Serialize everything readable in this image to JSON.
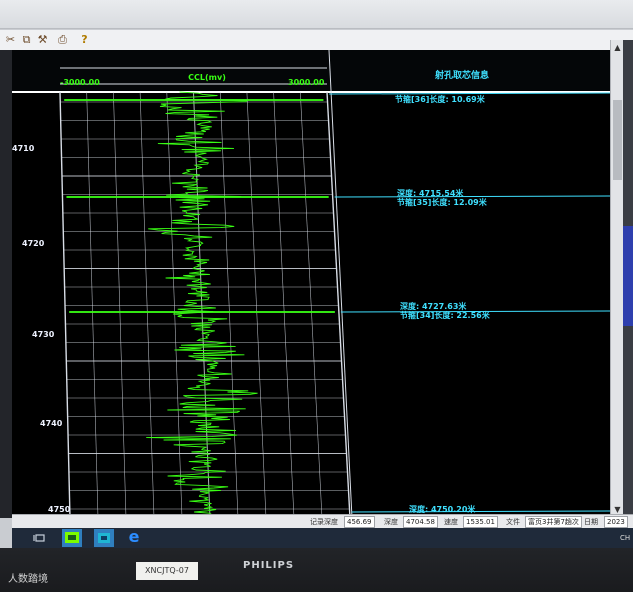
{
  "plot": {
    "ccl_title": "CCL(mv)",
    "ccl_min": "-3000.00",
    "ccl_max": "3000.00",
    "info_title": "射孔取芯信息",
    "depth_labels": [
      "4710",
      "4720",
      "4730",
      "4740",
      "4750"
    ]
  },
  "annotations": {
    "a36_length": "节箍[36]长度: 10.69米",
    "a35_depth": "深度: 4715.54米",
    "a35_length": "节箍[35]长度: 12.09米",
    "a34_depth": "深度: 4727.63米",
    "a34_length": "节箍[34]长度: 22.56米",
    "a33_depth": "深度: 4750.20米"
  },
  "status": {
    "record_depth_label": "记录深度",
    "record_depth_value": "456.69",
    "depth_label": "深度",
    "depth_value": "4704.58",
    "speed_label": "速度",
    "speed_value": "1535.01",
    "file_label": "文件",
    "file_value": "富页3井第7趟次",
    "date_label": "日期",
    "date_value": "2023"
  },
  "taskbar": {
    "clock_tail": "CH"
  },
  "bezel": {
    "brand": "PHILIPS",
    "sticker": "XNCJTQ-07",
    "watermark": "人数踏境"
  },
  "colors": {
    "trace": "#39ff14",
    "annotation": "#3fe0ff",
    "grid": "#d8dde6",
    "background": "#000000"
  }
}
